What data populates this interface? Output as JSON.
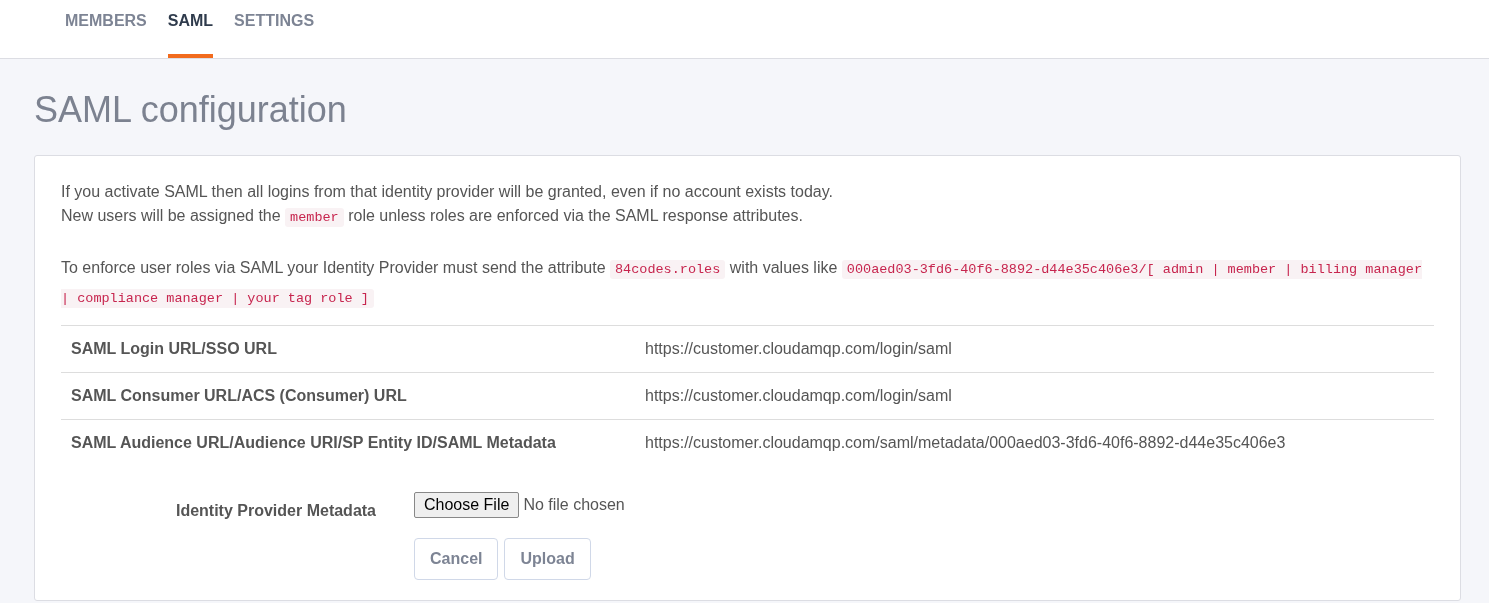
{
  "tabs": [
    {
      "label": "MEMBERS",
      "selected": false
    },
    {
      "label": "SAML",
      "selected": true
    },
    {
      "label": "SETTINGS",
      "selected": false
    }
  ],
  "title": "SAML configuration",
  "intro": [
    [
      {
        "kind": "text",
        "text": "If you activate SAML then all logins from that identity provider will be granted, even if no account exists today."
      }
    ],
    [
      {
        "kind": "text",
        "text": "New users will be assigned the "
      },
      {
        "kind": "code",
        "text": "member"
      },
      {
        "kind": "text",
        "text": " role unless roles are enforced via the SAML response attributes."
      }
    ]
  ],
  "roles_note": [
    {
      "kind": "text",
      "text": "To enforce user roles via SAML your Identity Provider must send the attribute "
    },
    {
      "kind": "code",
      "text": "84codes.roles"
    },
    {
      "kind": "text",
      "text": " with values like "
    },
    {
      "kind": "code",
      "text": "000aed03-3fd6-40f6-8892-d44e35c406e3/[ admin | member | billing manager | compliance manager | your tag role ]"
    }
  ],
  "table": {
    "rows": [
      {
        "label": "SAML Login URL/SSO URL",
        "value": "https://customer.cloudamqp.com/login/saml"
      },
      {
        "label": "SAML Consumer URL/ACS (Consumer) URL",
        "value": "https://customer.cloudamqp.com/login/saml"
      },
      {
        "label": "SAML Audience URL/Audience URI/SP Entity ID/SAML Metadata",
        "value": "https://customer.cloudamqp.com/saml/metadata/000aed03-3fd6-40f6-8892-d44e35c406e3"
      }
    ]
  },
  "upload": {
    "label": "Identity Provider Metadata",
    "choose_button": "Choose File",
    "file_status": "No file chosen",
    "buttons": [
      "Cancel",
      "Upload"
    ]
  }
}
